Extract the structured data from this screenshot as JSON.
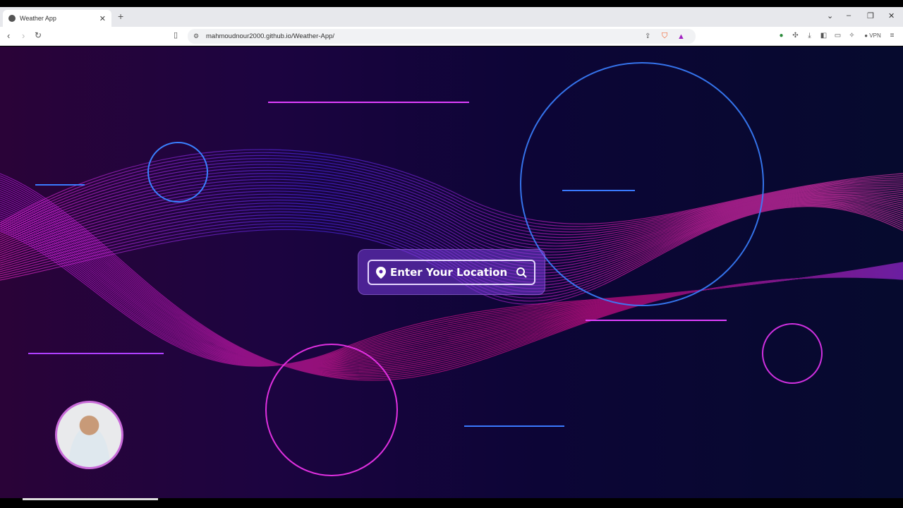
{
  "browser": {
    "tab_title": "Weather App",
    "url": "mahmoudnour2000.github.io/Weather-App/",
    "vpn_label": "VPN"
  },
  "app": {
    "search_placeholder": "Enter Your Location"
  }
}
